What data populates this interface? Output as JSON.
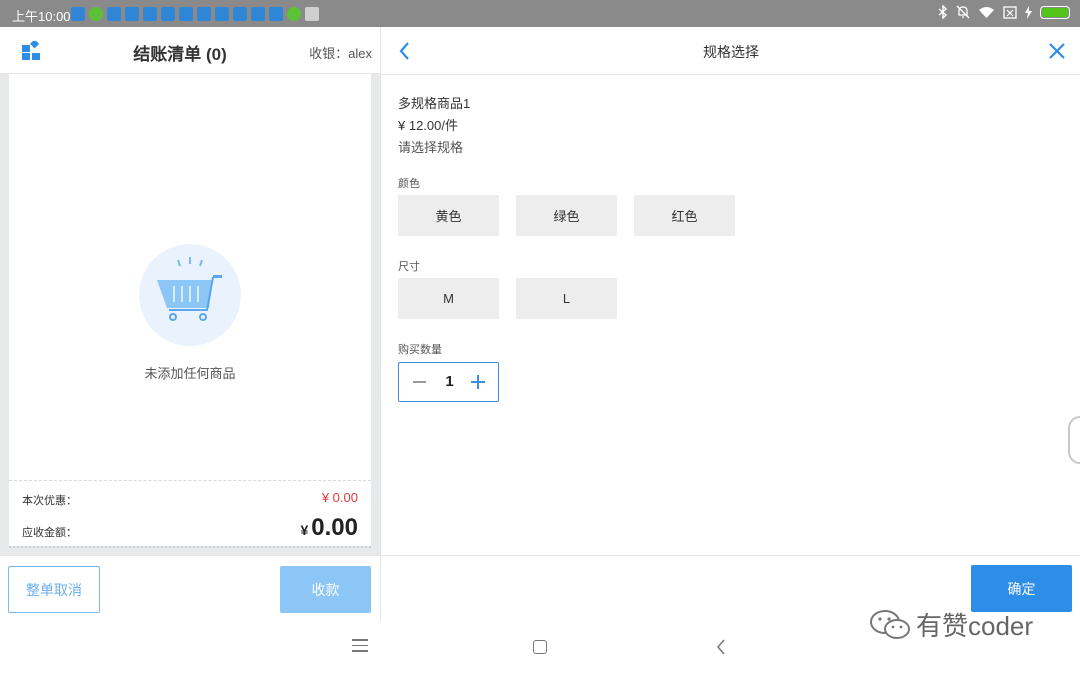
{
  "status_bar": {
    "time": "上午10:00",
    "app_icons": [
      "app-icon",
      "app-icon-green",
      "app-icon",
      "app-icon",
      "app-icon",
      "app-icon",
      "app-icon",
      "app-icon",
      "app-icon",
      "app-icon",
      "app-icon",
      "app-icon",
      "app-icon-green",
      "app-icon-gray"
    ]
  },
  "left_panel": {
    "title": "结账清单 (0)",
    "cashier": "收银：alex",
    "empty_text": "未添加任何商品",
    "discount_label": "本次优惠：",
    "discount_value": "¥ 0.00",
    "due_label": "应收金额：",
    "due_currency": "¥",
    "due_value": "0.00",
    "cancel_label": "整单取消",
    "pay_label": "收款"
  },
  "right_panel": {
    "title": "规格选择",
    "product_name": "多规格商品1",
    "product_price": "¥ 12.00/件",
    "spec_hint": "请选择规格",
    "color_label": "颜色",
    "colors": [
      "黄色",
      "绿色",
      "红色"
    ],
    "size_label": "尺寸",
    "sizes": [
      "M",
      "L"
    ],
    "quantity_label": "购买数量",
    "quantity": "1",
    "confirm_label": "确定"
  },
  "watermark": {
    "text": "有赞coder"
  },
  "colors": {
    "accent": "#2e8de6",
    "accent_light": "#8cc6f7",
    "discount_red": "#e0393e",
    "option_bg": "#ededed",
    "status_bar_bg": "#8a8a8a",
    "battery_green": "#52c41a"
  }
}
